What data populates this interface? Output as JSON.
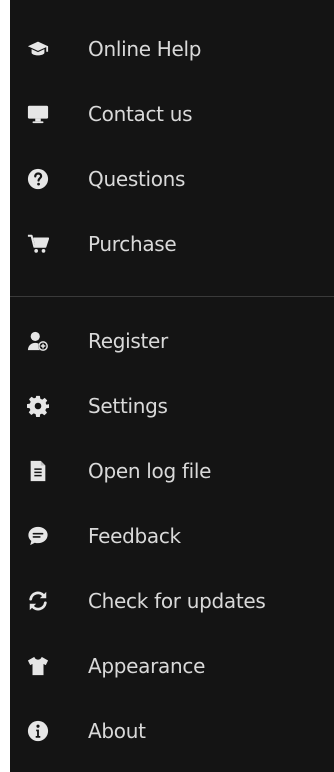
{
  "menu": {
    "top_items": [
      {
        "label": "Online Help",
        "icon": "graduation-cap-icon"
      },
      {
        "label": "Contact us",
        "icon": "monitor-icon"
      },
      {
        "label": "Questions",
        "icon": "question-circle-icon"
      },
      {
        "label": "Purchase",
        "icon": "shopping-cart-icon"
      }
    ],
    "bottom_items": [
      {
        "label": "Register",
        "icon": "user-plus-icon"
      },
      {
        "label": "Settings",
        "icon": "gear-icon"
      },
      {
        "label": "Open log file",
        "icon": "document-icon"
      },
      {
        "label": "Feedback",
        "icon": "chat-bubble-icon"
      },
      {
        "label": "Check for updates",
        "icon": "refresh-icon"
      },
      {
        "label": "Appearance",
        "icon": "t-shirt-icon"
      },
      {
        "label": "About",
        "icon": "info-circle-icon"
      }
    ]
  },
  "colors": {
    "background": "#141414",
    "text": "#d9d9d9",
    "icon": "#e6e6e6",
    "divider": "#3a3a3a"
  }
}
